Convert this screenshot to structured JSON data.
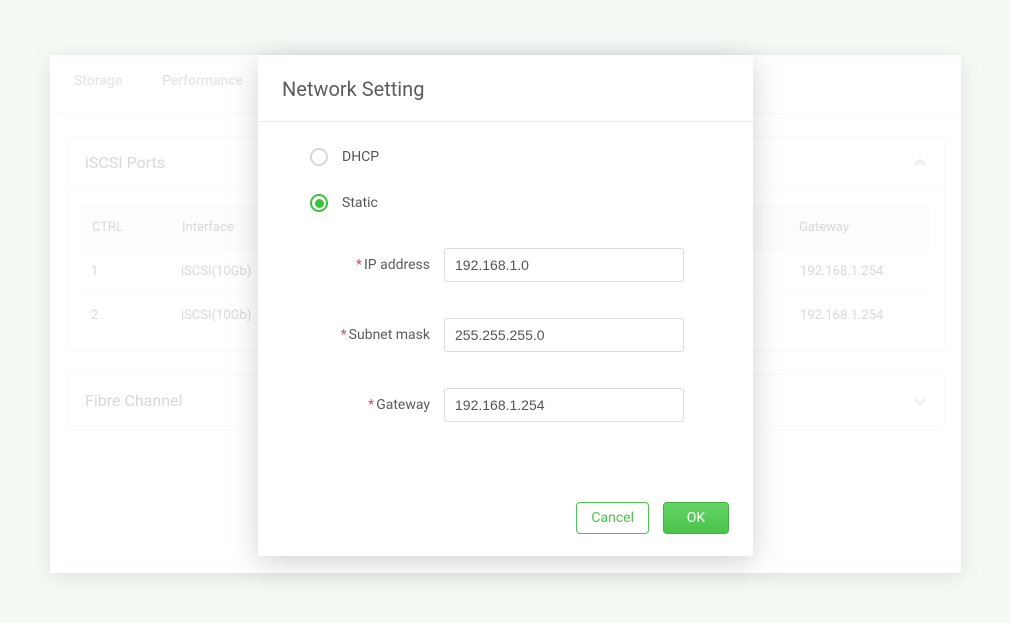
{
  "tabs": {
    "storage": "Storage",
    "performance": "Performance"
  },
  "iscsi": {
    "title": "iSCSI Ports",
    "columns": {
      "ctrl": "CTRL",
      "interface": "Interface",
      "gateway": "Gateway"
    },
    "rows": [
      {
        "ctrl": "1",
        "interface": "iSCSI(10Gb)",
        "gateway": "192.168.1.254"
      },
      {
        "ctrl": "2",
        "interface": "iSCSI(10Gb)",
        "gateway": "192.168.1.254"
      }
    ]
  },
  "fibre": {
    "title": "Fibre Channel"
  },
  "dialog": {
    "title": "Network Setting",
    "radios": {
      "dhcp": "DHCP",
      "static": "Static"
    },
    "fields": {
      "ip_label": "IP address",
      "ip_value": "192.168.1.0",
      "mask_label": "Subnet mask",
      "mask_value": "255.255.255.0",
      "gw_label": "Gateway",
      "gw_value": "192.168.1.254"
    },
    "buttons": {
      "cancel": "Cancel",
      "ok": "OK"
    }
  }
}
